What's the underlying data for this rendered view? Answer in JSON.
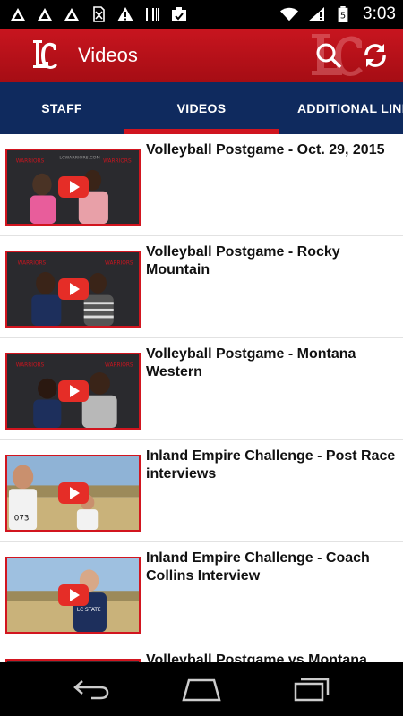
{
  "status_bar": {
    "time": "3:03",
    "left_icons": [
      "notification-icon",
      "notification-icon",
      "notification-icon",
      "sim-alert-icon",
      "warning-icon",
      "barcode-icon",
      "clipboard-check-icon"
    ],
    "right_icons": [
      "wifi-icon",
      "signal-icon",
      "battery-icon"
    ]
  },
  "app_bar": {
    "title": "Videos",
    "logo_text": "LC",
    "actions": [
      "search-icon",
      "refresh-icon"
    ]
  },
  "tabs": [
    {
      "label": "STAFF",
      "selected": false
    },
    {
      "label": "VIDEOS",
      "selected": true
    },
    {
      "label": "ADDITIONAL LINKS",
      "selected": false
    }
  ],
  "videos": [
    {
      "title": "Volleyball Postgame - Oct. 29, 2015"
    },
    {
      "title": "Volleyball Postgame - Rocky Mountain"
    },
    {
      "title": "Volleyball Postgame - Montana Western"
    },
    {
      "title": "Inland Empire Challenge - Post Race interviews"
    },
    {
      "title": "Inland Empire Challenge - Coach Collins Interview"
    },
    {
      "title": "Volleyball Postgame vs Montana"
    }
  ],
  "colors": {
    "primary_red": "#c8151f",
    "tab_navy": "#0f2a5e",
    "play_red": "#e52d27"
  }
}
